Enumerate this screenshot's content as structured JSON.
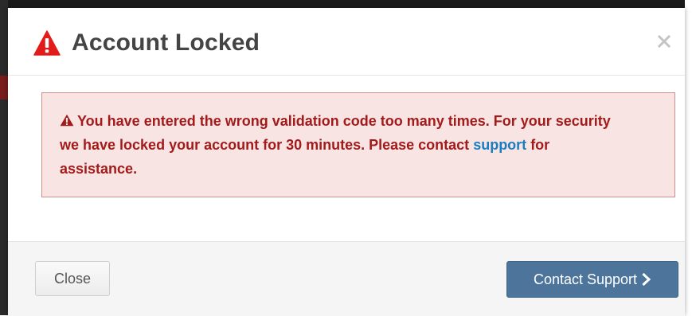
{
  "modal": {
    "title": "Account Locked",
    "title_icon": "warning-triangle-icon",
    "close_icon": "close-icon"
  },
  "alert": {
    "icon": "warning-triangle-icon",
    "text_before_link": "You have entered the wrong validation code too many times. For your security we have locked your account for 30 minutes. Please contact ",
    "link_text": "support",
    "text_after_link": " for assistance."
  },
  "footer": {
    "close_label": "Close",
    "support_label": "Contact Support",
    "support_icon": "chevron-right-icon"
  },
  "colors": {
    "title_icon": "#e21b1b",
    "alert_background": "#f9e4e4",
    "alert_border": "#c9908e",
    "alert_text": "#a21b1b",
    "link": "#1a7dc0",
    "primary_button": "#4d759c"
  }
}
